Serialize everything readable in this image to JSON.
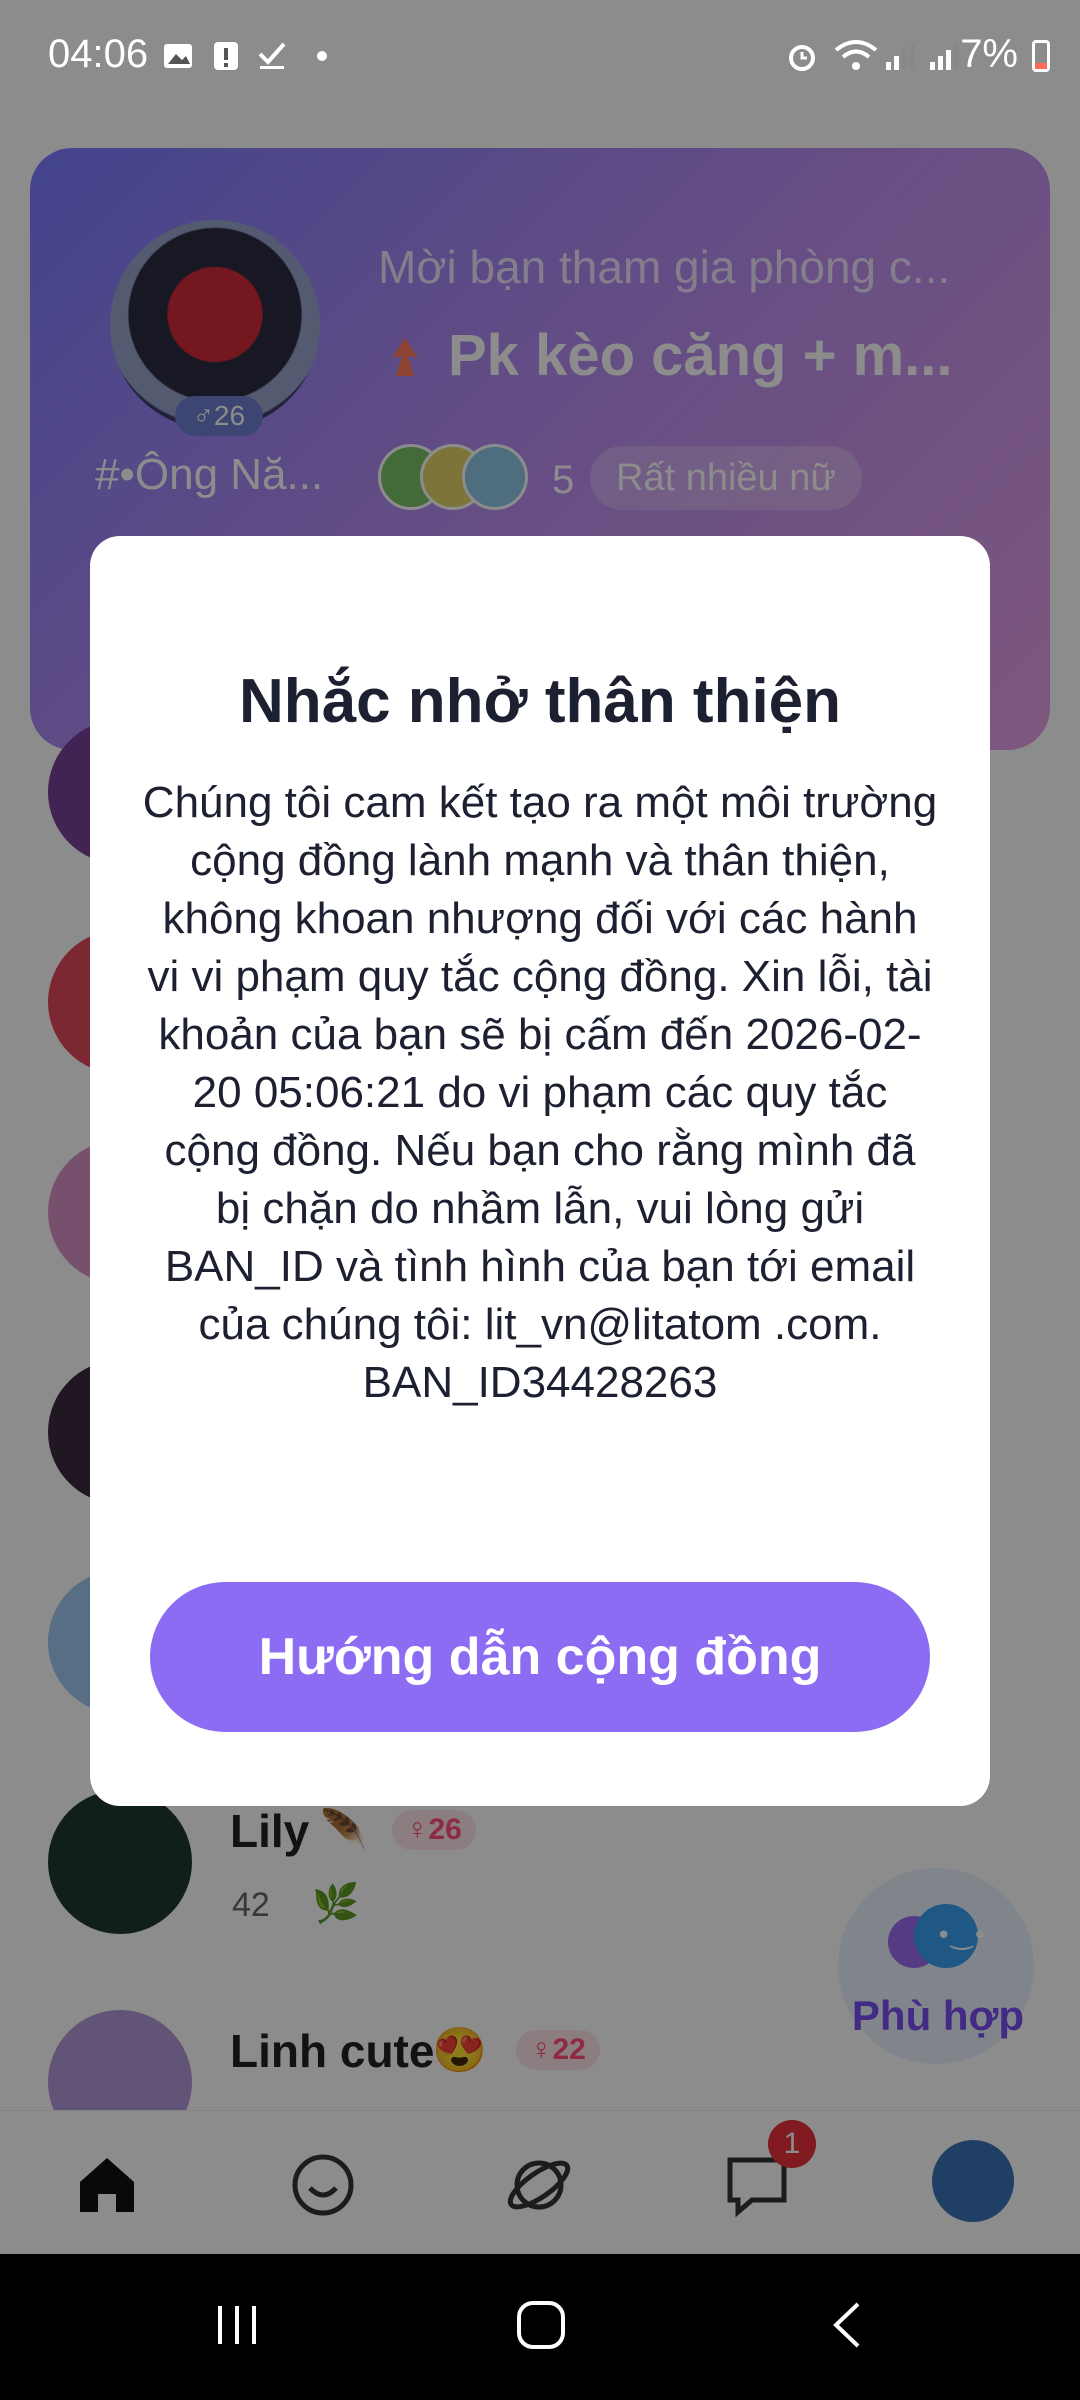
{
  "status_bar": {
    "time": "04:06",
    "battery": "7%",
    "icons": [
      "image-icon",
      "alert-icon",
      "check-icon",
      "dot-icon",
      "alarm-icon",
      "wifi-icon",
      "signal-icon",
      "signal-icon",
      "battery-icon"
    ]
  },
  "room_card": {
    "invite_text": "Mời bạn tham gia phòng c...",
    "room_name": "Pk kèo căng + m...",
    "owner_name": "#•Ông Nă...",
    "owner_gender_age": "♂26",
    "member_count": "5",
    "tag": "Rất nhiều nữ"
  },
  "user_list": [
    {
      "name": "Lily",
      "emoji": "🪶",
      "badge": "♀26",
      "level": "42",
      "leaf": "🌿"
    },
    {
      "name": "Linh cute",
      "emoji": "😍",
      "badge": "♀22"
    }
  ],
  "match_button": {
    "label": "Phù hợp"
  },
  "bottom_nav": {
    "items": [
      "home-icon",
      "party-icon",
      "planet-icon",
      "chat-icon",
      "profile-icon"
    ],
    "chat_badge": "1"
  },
  "dialog": {
    "title": "Nhắc nhở thân thiện",
    "body": "Chúng tôi cam kết tạo ra một môi trường cộng đồng lành mạnh và thân thiện, không khoan nhượng đối với các hành vi vi phạm quy tắc cộng đồng. Xin lỗi, tài khoản của bạn sẽ bị cấm đến 2026-02-20 05:06:21 do vi phạm các quy tắc cộng đồng. Nếu bạn cho rằng mình đã bị chặn do nhầm lẫn, vui lòng gửi BAN_ID và tình hình của bạn tới email của chúng tôi: lit_vn@litatom .com. BAN_ID34428263",
    "button_label": "Hướng dẫn cộng đồng"
  },
  "colors": {
    "accent": "#8b6cf2",
    "badge_red": "#e8323c",
    "text_dark": "#1c2030"
  }
}
